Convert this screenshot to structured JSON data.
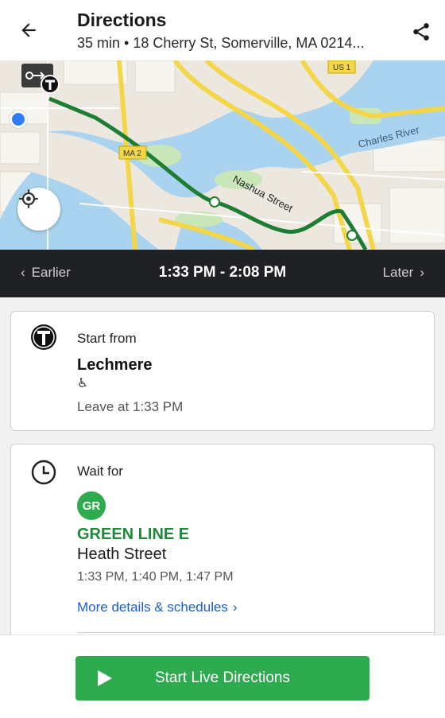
{
  "header": {
    "title": "Directions",
    "subtitle": "35 min • 18 Cherry St, Somerville, MA 0214..."
  },
  "map": {
    "labels": {
      "river": "Charles River",
      "street": "Nashua Street",
      "shield_us1": "US 1",
      "shield_ma": "MA 2"
    },
    "route_color": "#1e7d32",
    "water_color": "#a9d3ee"
  },
  "timebar": {
    "earlier": "Earlier",
    "range": "1:33 PM - 2:08 PM",
    "later": "Later"
  },
  "steps": [
    {
      "label": "Start from",
      "stop": "Lechmere",
      "accessible_icon": "♿",
      "leave_at": "Leave at 1:33 PM"
    },
    {
      "label": "Wait for",
      "badge": "GR",
      "line": "GREEN LINE E",
      "headsign": "Heath Street",
      "times": "1:33 PM, 1:40 PM, 1:47 PM",
      "more": "More details & schedules"
    }
  ],
  "bottom": {
    "start_label": "Start Live Directions"
  },
  "colors": {
    "accent_green": "#2eaa4f",
    "line_green": "#1d8a3a",
    "link_blue": "#1a5fc8",
    "timebar_bg": "#202124"
  }
}
